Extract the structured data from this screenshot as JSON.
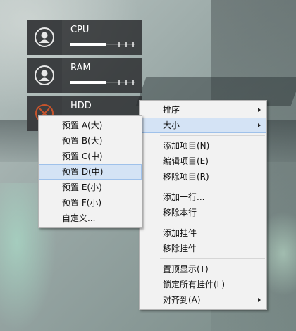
{
  "gadgets": [
    {
      "id": "cpu",
      "label": "CPU",
      "icon": "user-silhouette-icon",
      "usage": 0.55
    },
    {
      "id": "ram",
      "label": "RAM",
      "icon": "user-silhouette-icon",
      "usage": 0.55
    },
    {
      "id": "hdd",
      "label": "HDD",
      "icon": "close-circle-icon"
    }
  ],
  "main_menu": {
    "sort": "排序",
    "size": "大小",
    "add_item": "添加项目(N)",
    "edit_item": "编辑项目(E)",
    "remove_item": "移除项目(R)",
    "add_row": "添加一行...",
    "remove_row": "移除本行",
    "add_gadget": "添加挂件",
    "remove_gadget": "移除挂件",
    "topmost": "置顶显示(T)",
    "lock_all": "锁定所有挂件(L)",
    "align_to": "对齐到(A)"
  },
  "size_submenu": {
    "items": [
      "预置 A(大)",
      "预置 B(大)",
      "预置 C(中)",
      "预置 D(中)",
      "预置 E(小)",
      "预置 F(小)",
      "自定义..."
    ],
    "selected": "预置 D(中)"
  },
  "colors": {
    "menu_bg": "#f2f2f2",
    "highlight": "#d4e3f5",
    "gadget_bg": "#2a2c2e",
    "hdd_icon": "#c8542c"
  }
}
